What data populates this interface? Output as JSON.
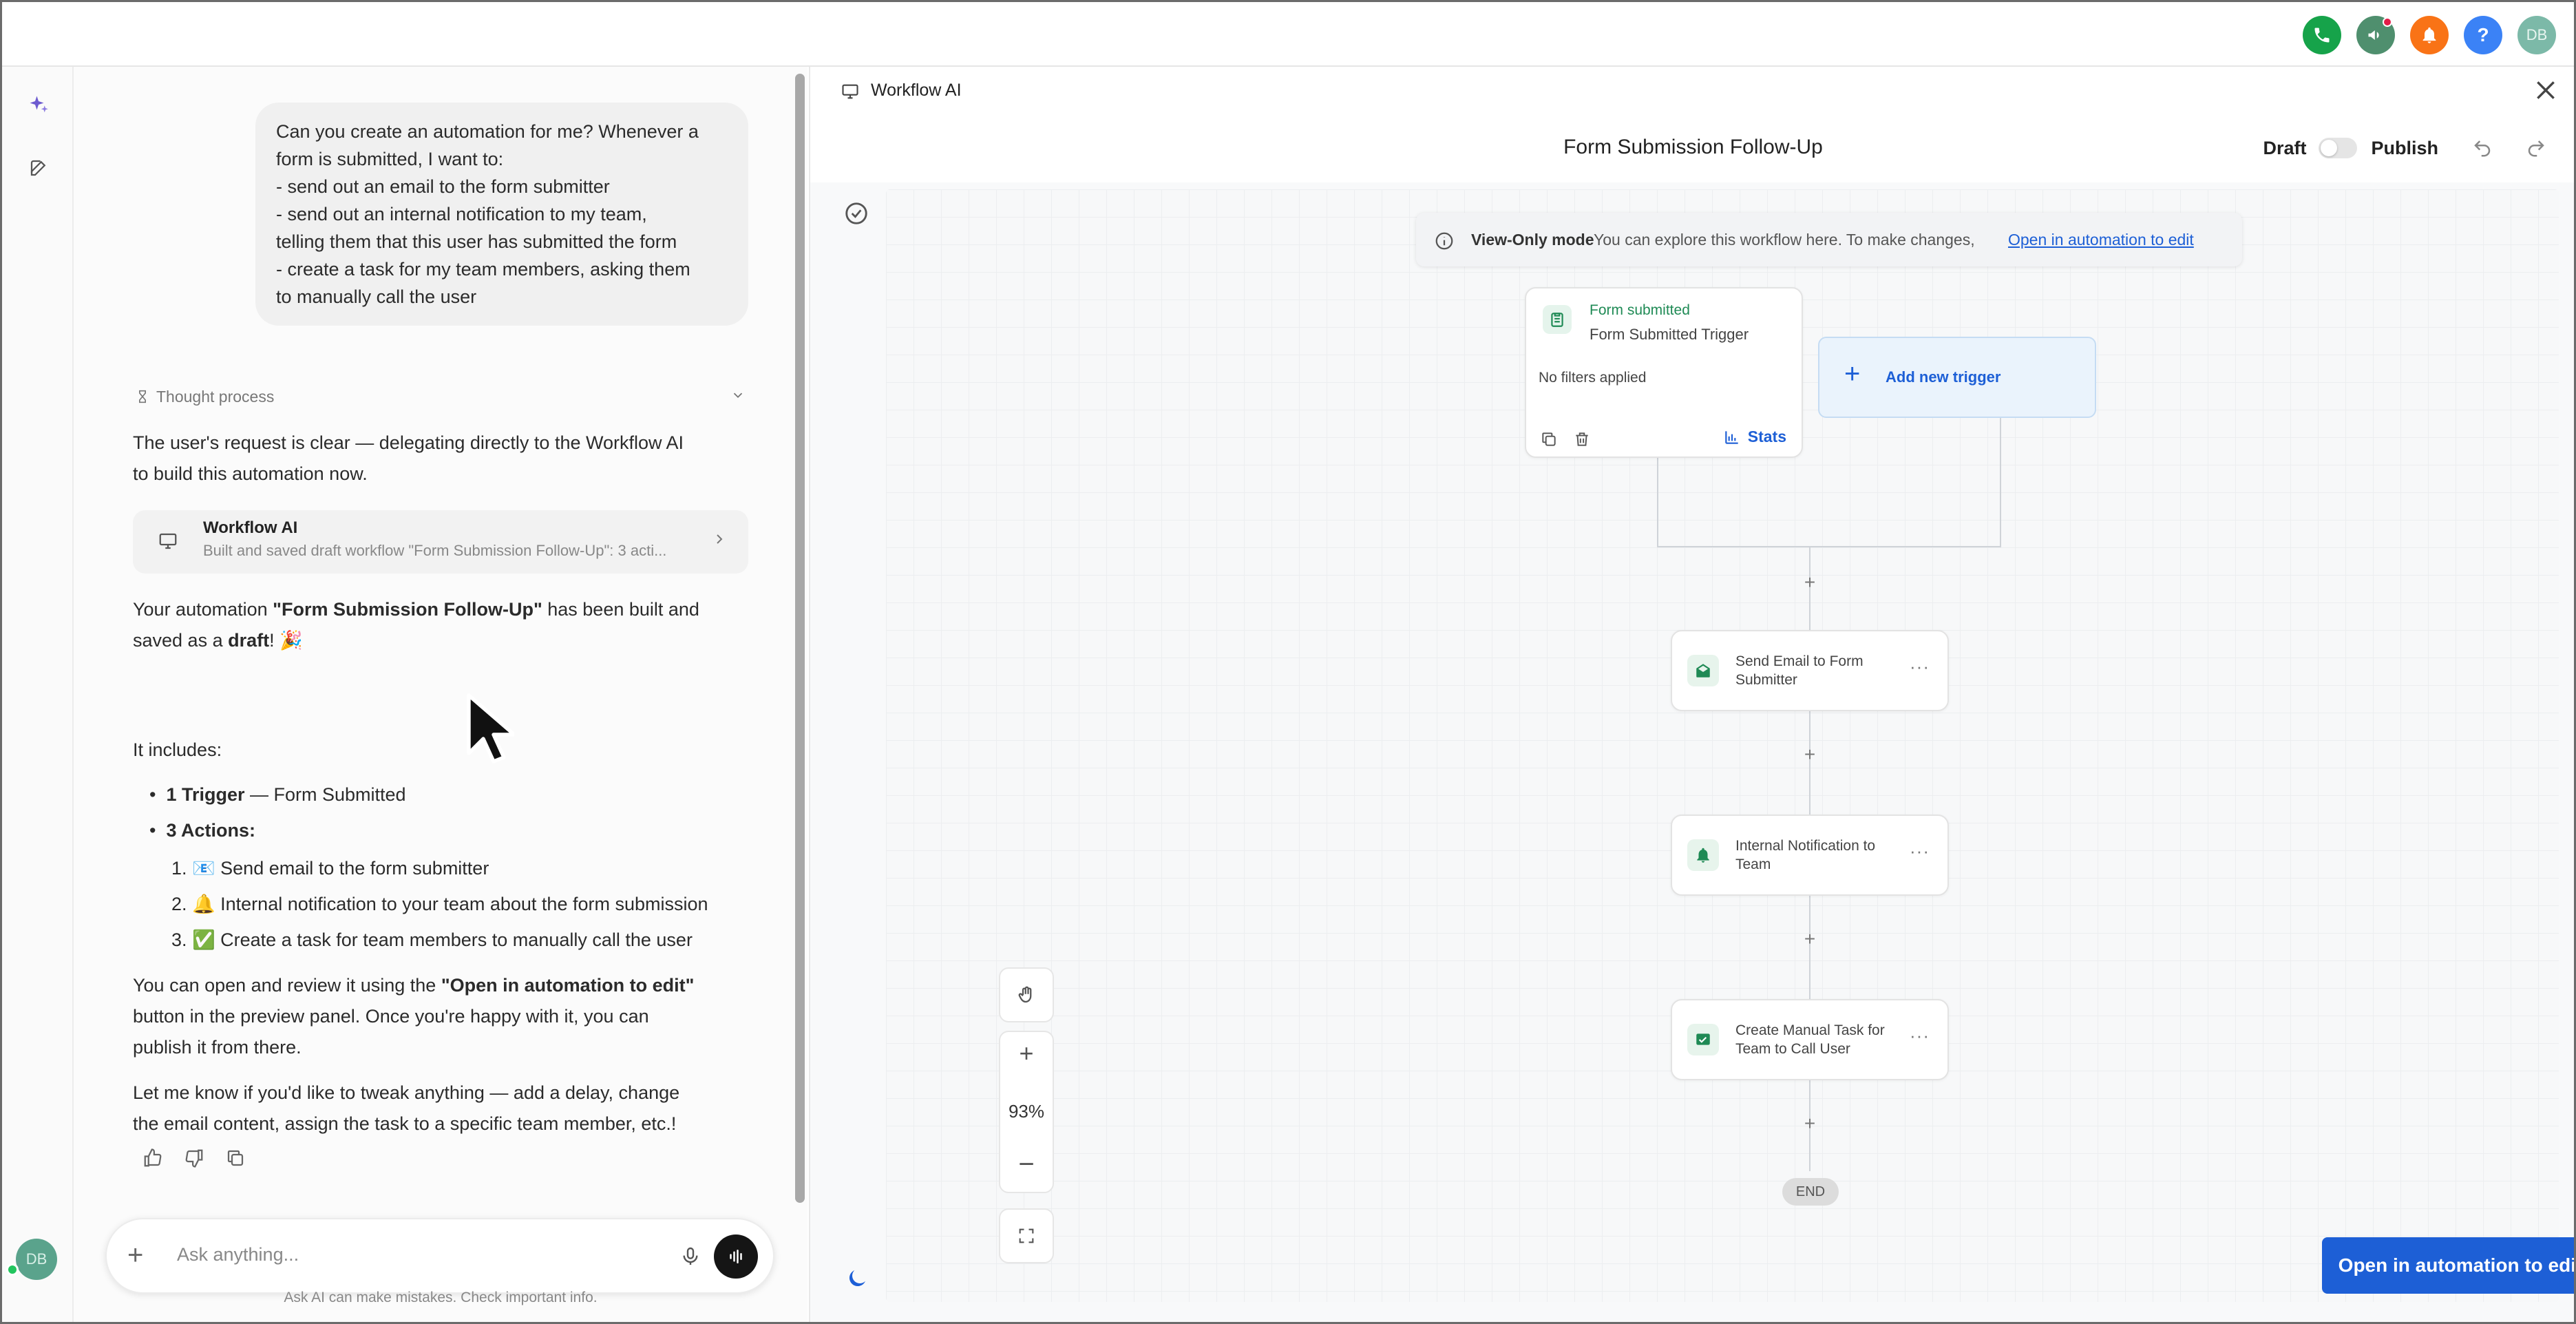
{
  "topbar": {
    "icons": [
      "phone-icon",
      "megaphone-icon",
      "bell-icon",
      "help-icon"
    ],
    "avatar_initials": "DB"
  },
  "rail": {
    "avatar_initials": "DB"
  },
  "chat": {
    "user_message": "Can you create an automation for me? Whenever a\nform is submitted, I want to:\n- send out an email to the form submitter\n- send out an internal notification to my team,\ntelling them that this user has submitted the form\n- create a task for my team members, asking them\nto manually call the user",
    "thought_label": "Thought process",
    "intro_line1": "The user's request is clear — delegating directly to the Workflow AI",
    "intro_line2": "to build this automation now.",
    "tool_card": {
      "title": "Workflow AI",
      "subtitle": "Built and saved draft workflow \"Form Submission Follow-Up\": 3 acti..."
    },
    "built_pre": "Your automation ",
    "built_name": "\"Form Submission Follow-Up\"",
    "built_post": " has been built and",
    "built_line2_pre": "saved as a ",
    "built_line2_bold": "draft",
    "built_line2_post": "! 🎉",
    "includes": "It includes:",
    "bullet1_bold": "1 Trigger",
    "bullet1_rest": " — Form Submitted",
    "bullet2_bold": "3 Actions:",
    "actions": [
      "📧 Send email to the form submitter",
      "🔔 Internal notification to your team about the form submission",
      "✅ Create a task for team members to manually call the user"
    ],
    "open_pre": "You can open and review it using the ",
    "open_bold": "\"Open in automation to edit\"",
    "open_line2": "button in the preview panel. Once you're happy with it, you can",
    "open_line3": "publish it from there.",
    "tweak_line1": "Let me know if you'd like to tweak anything — add a delay, change",
    "tweak_line2": "the email content, assign the task to a specific team member, etc.!",
    "input_placeholder": "Ask anything...",
    "disclaimer": "Ask AI can make mistakes. Check important info."
  },
  "panel": {
    "header_title": "Workflow AI",
    "workflow_title": "Form Submission Follow-Up",
    "draft_label": "Draft",
    "publish_label": "Publish",
    "viewonly_bold": "View-Only mode",
    "viewonly_msg": "You can explore this workflow here. To make changes,",
    "viewonly_link": "Open in automation to edit",
    "trigger": {
      "type": "Form submitted",
      "name": "Form Submitted Trigger",
      "filters": "No filters applied",
      "stats": "Stats"
    },
    "add_trigger": "Add new trigger",
    "actions": [
      "Send Email to Form Submitter",
      "Internal Notification to Team",
      "Create Manual Task for Team to Call User"
    ],
    "end_label": "END",
    "zoom_level": "93%",
    "open_button": "Open in automation to edit"
  }
}
